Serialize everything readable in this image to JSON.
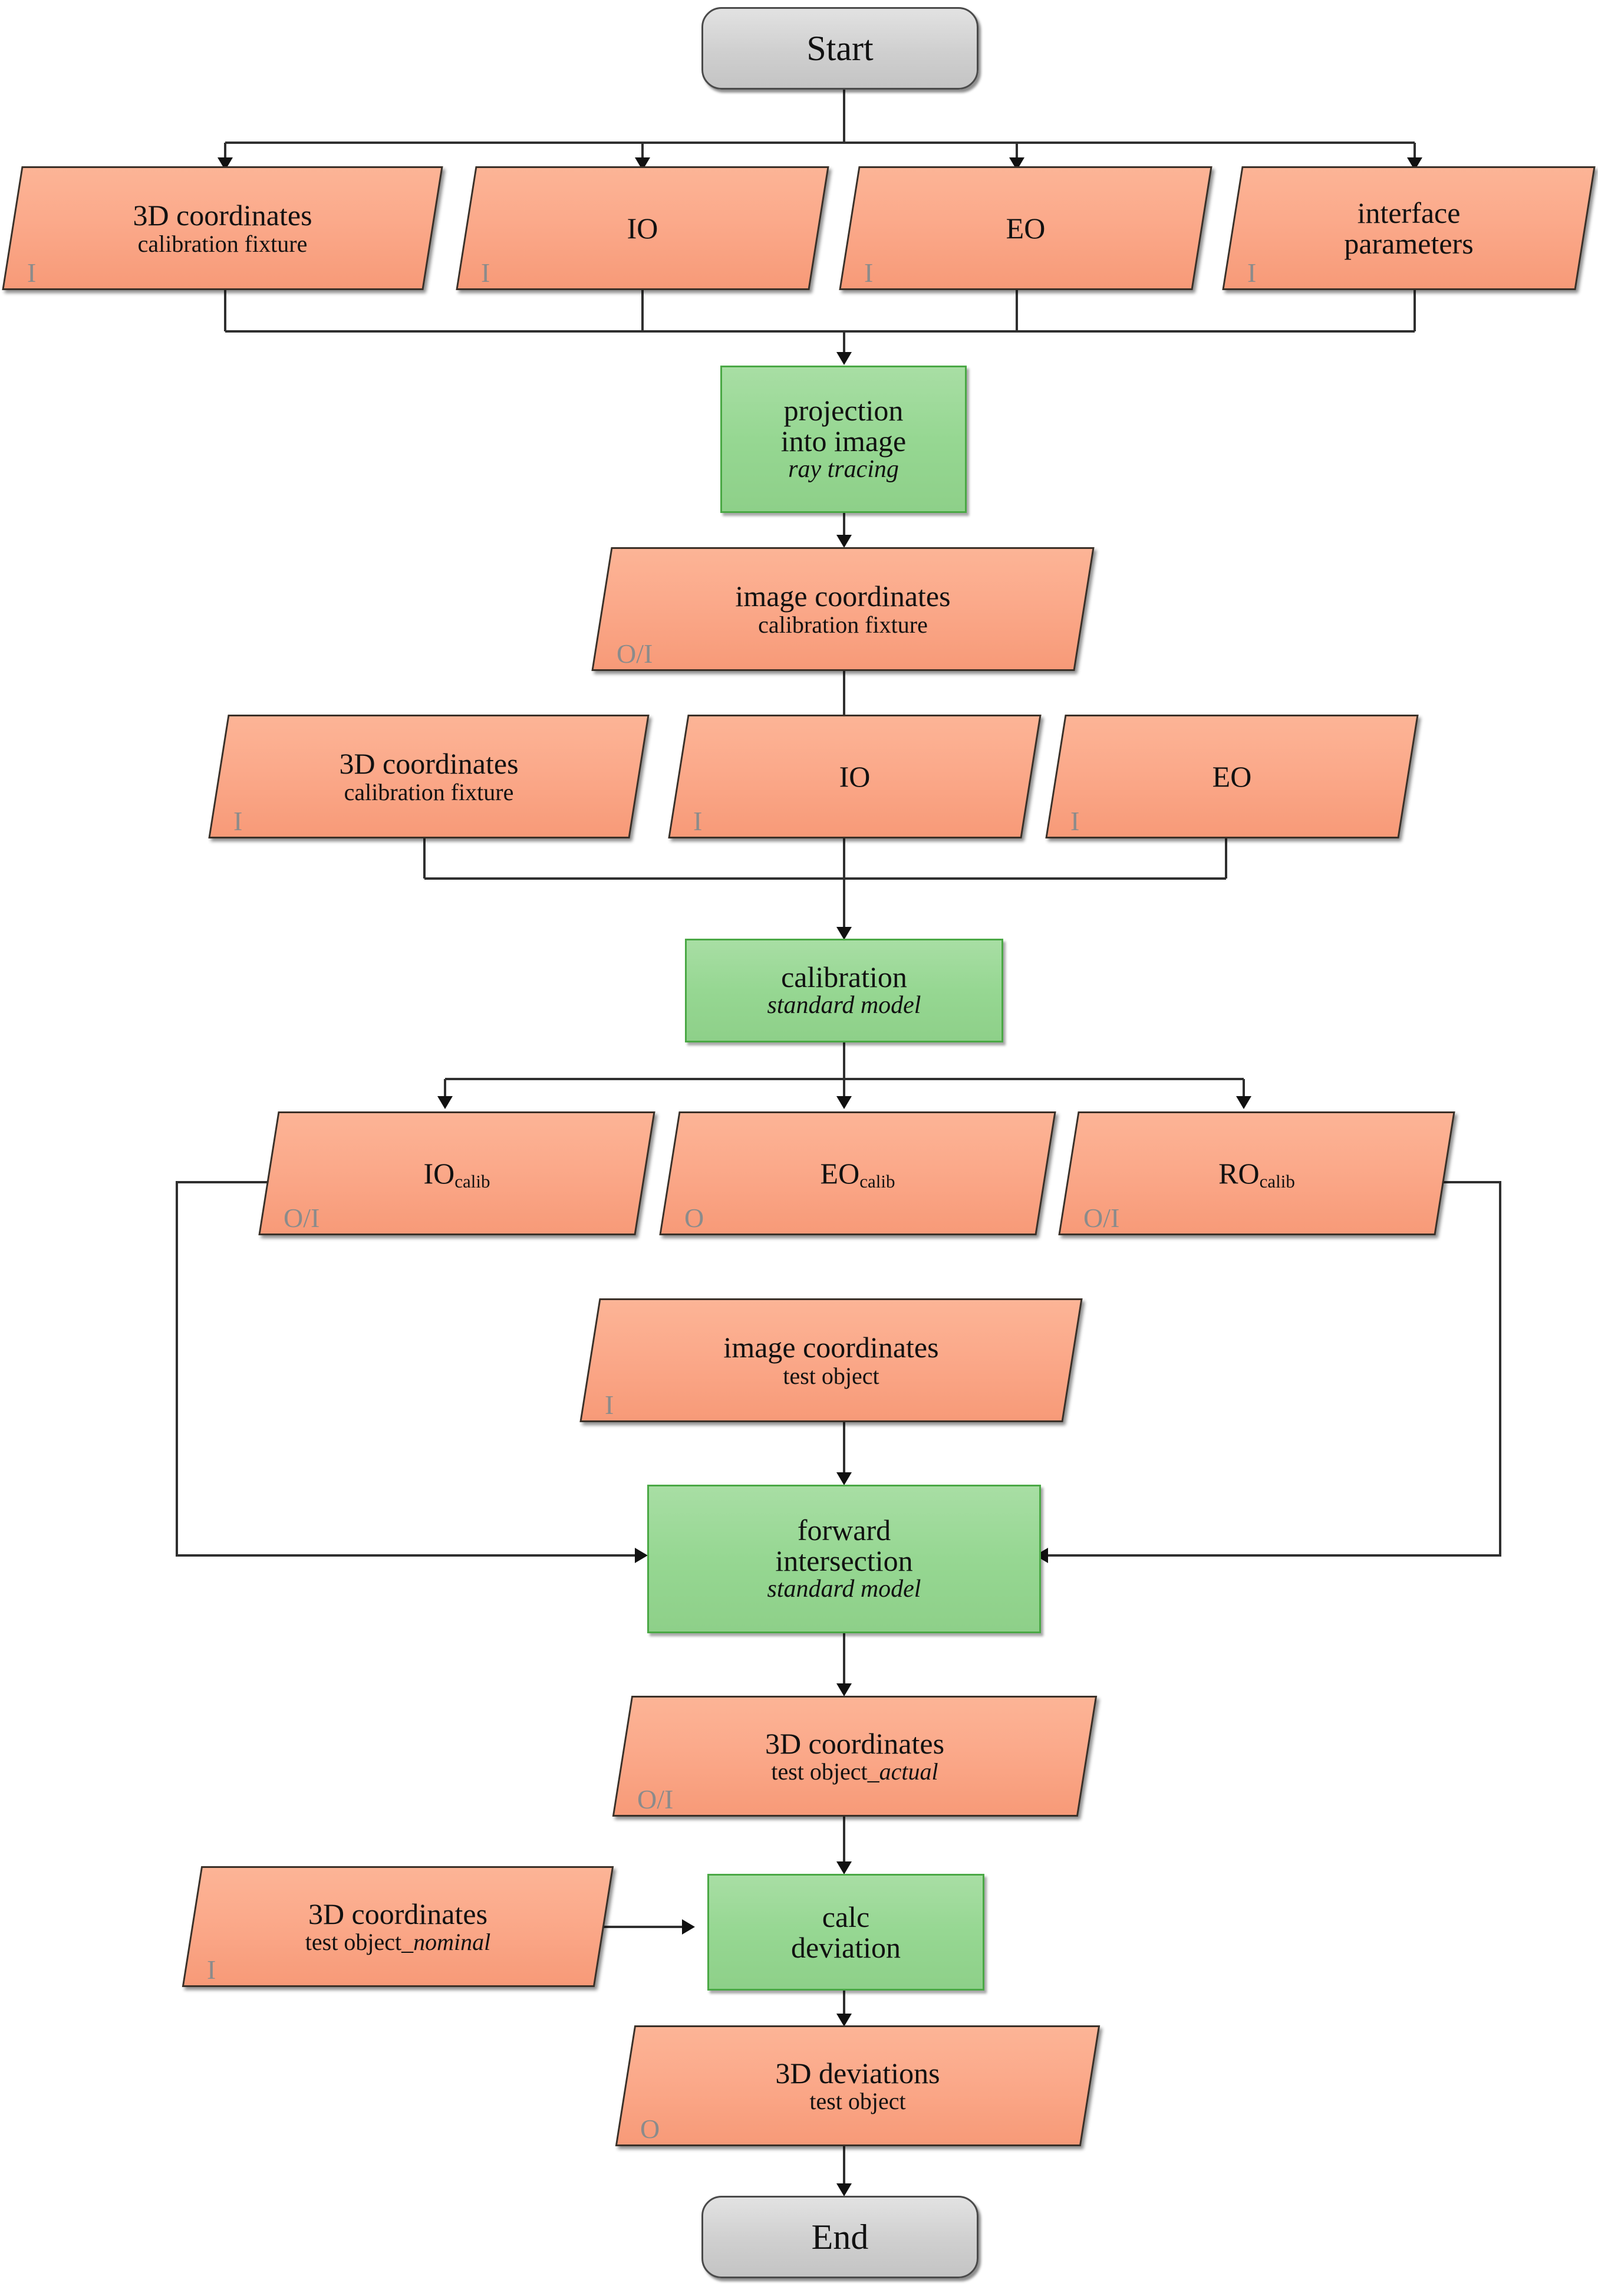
{
  "title": "Simulation and calibration workflow flowchart",
  "palette": {
    "data_fill": "#fbab8c",
    "process_fill": "#96d792",
    "process_stroke": "#4aa845",
    "terminator_fill": "#cfcfcf",
    "terminator_stroke": "#4a4a4a",
    "io_marker": "#8b8b8b",
    "connector": "#3a3a3a",
    "background": "#ffffff"
  },
  "legend_markers": {
    "input": "I",
    "output": "O",
    "both": "O/I"
  },
  "nodes": {
    "start": {
      "label": "Start",
      "type": "terminator"
    },
    "end": {
      "label": "End",
      "type": "terminator"
    },
    "in_3d_coords_fixture": {
      "line1": "3D coordinates",
      "line2": "calibration fixture",
      "io": "I",
      "type": "data"
    },
    "in_io": {
      "line1": "IO",
      "line2": "",
      "io": "I",
      "type": "data"
    },
    "in_eo": {
      "line1": "EO",
      "line2": "",
      "io": "I",
      "type": "data"
    },
    "in_interface_parameters": {
      "line1": "interface",
      "line2": "parameters",
      "io": "I",
      "type": "data"
    },
    "proc_projection": {
      "line1": "projection",
      "line2": "into image",
      "sub": "ray tracing",
      "type": "process"
    },
    "img_coords_fixture": {
      "line1": "image coordinates",
      "line2": "calibration fixture",
      "io": "O/I",
      "type": "data"
    },
    "in2_3d_coords_fixture": {
      "line1": "3D coordinates",
      "line2": "calibration fixture",
      "io": "I",
      "type": "data"
    },
    "in2_io": {
      "line1": "IO",
      "line2": "",
      "io": "I",
      "type": "data"
    },
    "in2_eo": {
      "line1": "EO",
      "line2": "",
      "io": "I",
      "type": "data"
    },
    "proc_calibration": {
      "line1": "calibration",
      "sub": "standard model",
      "type": "process"
    },
    "io_calib": {
      "base": "IO",
      "subscript": "calib",
      "io": "O/I",
      "type": "data"
    },
    "eo_calib": {
      "base": "EO",
      "subscript": "calib",
      "io": "O",
      "type": "data"
    },
    "ro_calib": {
      "base": "RO",
      "subscript": "calib",
      "io": "O/I",
      "type": "data"
    },
    "img_coords_testobject": {
      "line1": "image coordinates",
      "line2": "test object",
      "io": "I",
      "type": "data"
    },
    "proc_forward_intersection": {
      "line1": "forward",
      "line2": "intersection",
      "sub": "standard model",
      "type": "process"
    },
    "coords_test_actual": {
      "line1": "3D coordinates",
      "line2_plain": "test object_",
      "line2_italic": "actual",
      "io": "O/I",
      "type": "data"
    },
    "coords_test_nominal": {
      "line1": "3D coordinates",
      "line2_plain": "test object_",
      "line2_italic": "nominal",
      "io": "I",
      "type": "data"
    },
    "proc_calc_deviation": {
      "line1": "calc",
      "line2": "deviation",
      "type": "process"
    },
    "deviations_testobject": {
      "line1": "3D deviations",
      "line2": "test object",
      "io": "O",
      "type": "data"
    }
  },
  "flow": {
    "edges": [
      "start -> in_3d_coords_fixture",
      "start -> in_io",
      "start -> in_eo",
      "start -> in_interface_parameters",
      "in_3d_coords_fixture,in_io,in_eo,in_interface_parameters -> proc_projection",
      "proc_projection -> img_coords_fixture",
      "img_coords_fixture,in2_3d_coords_fixture,in2_io,in2_eo -> proc_calibration",
      "proc_calibration -> io_calib",
      "proc_calibration -> eo_calib",
      "proc_calibration -> ro_calib",
      "io_calib -> proc_forward_intersection",
      "ro_calib -> proc_forward_intersection",
      "img_coords_testobject -> proc_forward_intersection",
      "proc_forward_intersection -> coords_test_actual",
      "coords_test_actual -> proc_calc_deviation",
      "coords_test_nominal -> proc_calc_deviation",
      "proc_calc_deviation -> deviations_testobject",
      "deviations_testobject -> end"
    ]
  }
}
